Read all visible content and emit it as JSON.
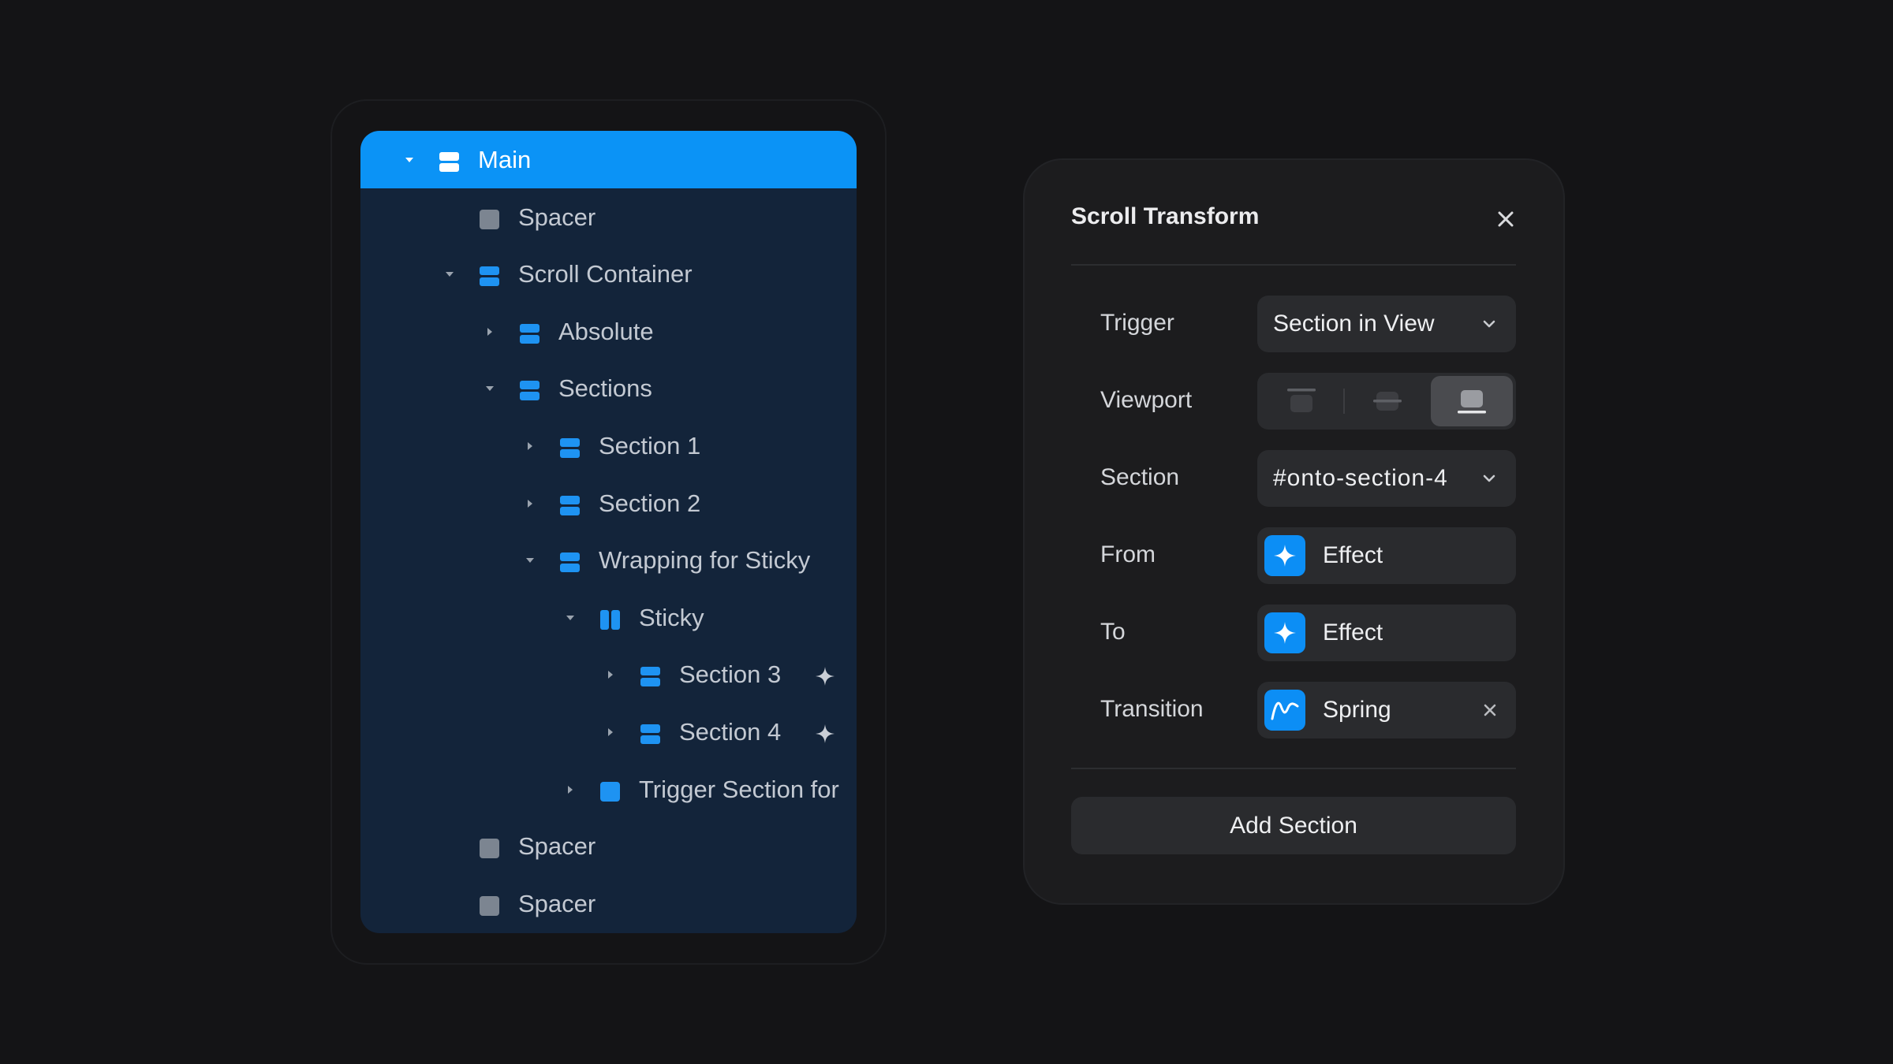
{
  "layers": {
    "rows": [
      {
        "label": "Main",
        "depth": 0,
        "expanded": true,
        "icon": "stack-icon",
        "selected": true
      },
      {
        "label": "Spacer",
        "depth": 1,
        "icon": "frame-icon"
      },
      {
        "label": "Scroll Container",
        "depth": 1,
        "expanded": true,
        "icon": "stack-icon"
      },
      {
        "label": "Absolute",
        "depth": 2,
        "expanded": false,
        "icon": "stack-icon"
      },
      {
        "label": "Sections",
        "depth": 2,
        "expanded": true,
        "icon": "stack-icon"
      },
      {
        "label": "Section 1",
        "depth": 3,
        "expanded": false,
        "icon": "stack-icon"
      },
      {
        "label": "Section 2",
        "depth": 3,
        "expanded": false,
        "icon": "stack-icon"
      },
      {
        "label": "Wrapping for Sticky",
        "depth": 3,
        "expanded": true,
        "icon": "stack-icon"
      },
      {
        "label": "Sticky",
        "depth": 4,
        "expanded": true,
        "icon": "columns-icon"
      },
      {
        "label": "Section 3",
        "depth": 5,
        "expanded": false,
        "icon": "stack-icon",
        "effect": true
      },
      {
        "label": "Section 4",
        "depth": 5,
        "expanded": false,
        "icon": "stack-icon",
        "effect": true
      },
      {
        "label": "Trigger Section for",
        "depth": 4,
        "expanded": false,
        "icon": "frame-blue-icon"
      },
      {
        "label": "Spacer",
        "depth": 1,
        "icon": "frame-icon"
      },
      {
        "label": "Spacer",
        "depth": 1,
        "icon": "frame-icon"
      }
    ]
  },
  "scroll_transform": {
    "title": "Scroll Transform",
    "trigger": {
      "label": "Trigger",
      "value": "Section in View"
    },
    "viewport": {
      "label": "Viewport",
      "options": [
        "viewport-top-icon",
        "viewport-center-icon",
        "viewport-bottom-icon"
      ],
      "selected_index": 2
    },
    "section": {
      "label": "Section",
      "value": "#onto-section-4"
    },
    "from": {
      "label": "From",
      "value": "Effect",
      "icon": "sparkle-icon"
    },
    "to": {
      "label": "To",
      "value": "Effect",
      "icon": "sparkle-icon"
    },
    "transition": {
      "label": "Transition",
      "value": "Spring",
      "icon": "spring-curve-icon"
    },
    "add_button": "Add Section"
  },
  "colors": {
    "background": "#141416",
    "tree_background": "#13243a",
    "selected_row": "#0b93f6",
    "accent_icon": "#1e93f2",
    "neutral_icon": "#7c8591",
    "panel": "#1c1c1e",
    "field": "#2a2b2e"
  }
}
